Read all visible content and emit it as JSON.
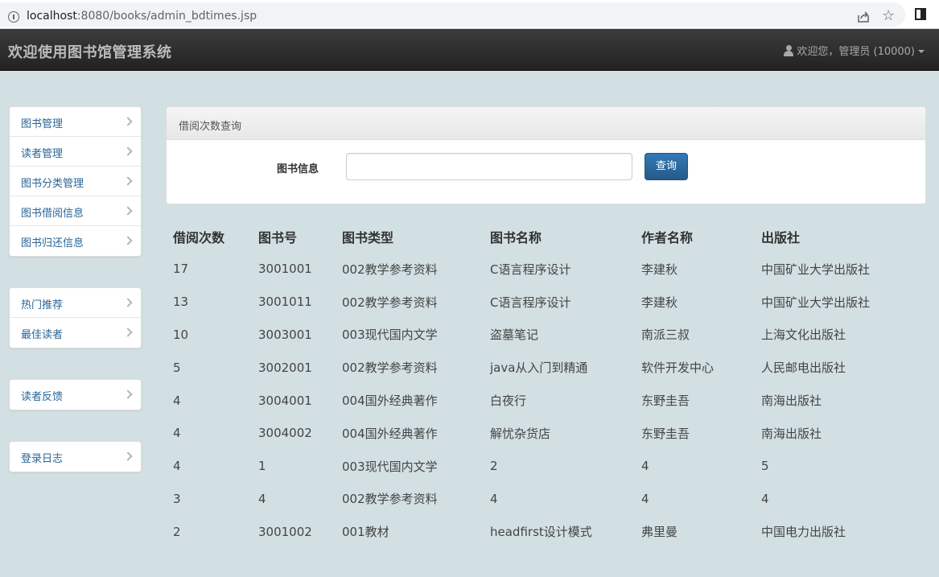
{
  "browser": {
    "url_host": "localhost",
    "url_path": ":8080/books/admin_bdtimes.jsp"
  },
  "navbar": {
    "brand": "欢迎使用图书馆管理系统",
    "user_label": "欢迎您，管理员 (10000)"
  },
  "sidebar": {
    "group1": [
      {
        "label": "图书管理"
      },
      {
        "label": "读者管理"
      },
      {
        "label": "图书分类管理"
      },
      {
        "label": "图书借阅信息"
      },
      {
        "label": "图书归还信息"
      }
    ],
    "group2": [
      {
        "label": "热门推荐"
      },
      {
        "label": "最佳读者"
      }
    ],
    "group3": [
      {
        "label": "读者反馈"
      }
    ],
    "group4": [
      {
        "label": "登录日志"
      }
    ]
  },
  "search_panel": {
    "title": "借阅次数查询",
    "field_label": "图书信息",
    "input_value": "",
    "button_label": "查询"
  },
  "table": {
    "headers": [
      "借阅次数",
      "图书号",
      "图书类型",
      "图书名称",
      "作者名称",
      "出版社"
    ],
    "rows": [
      [
        "17",
        "3001001",
        "002教学参考资料",
        "C语言程序设计",
        "李建秋",
        "中国矿业大学出版社"
      ],
      [
        "13",
        "3001011",
        "002教学参考资料",
        "C语言程序设计",
        "李建秋",
        "中国矿业大学出版社"
      ],
      [
        "10",
        "3003001",
        "003现代国内文学",
        "盗墓笔记",
        "南派三叔",
        "上海文化出版社"
      ],
      [
        "5",
        "3002001",
        "002教学参考资料",
        "java从入门到精通",
        "软件开发中心",
        "人民邮电出版社"
      ],
      [
        "4",
        "3004001",
        "004国外经典著作",
        "白夜行",
        "东野圭吾",
        "南海出版社"
      ],
      [
        "4",
        "3004002",
        "004国外经典著作",
        "解忧杂货店",
        "东野圭吾",
        "南海出版社"
      ],
      [
        "4",
        "1",
        "003现代国内文学",
        "2",
        "4",
        "5"
      ],
      [
        "3",
        "4",
        "002教学参考资料",
        "4",
        "4",
        "4"
      ],
      [
        "2",
        "3001002",
        "001教材",
        "headfirst设计模式",
        "弗里曼",
        "中国电力出版社"
      ]
    ]
  }
}
